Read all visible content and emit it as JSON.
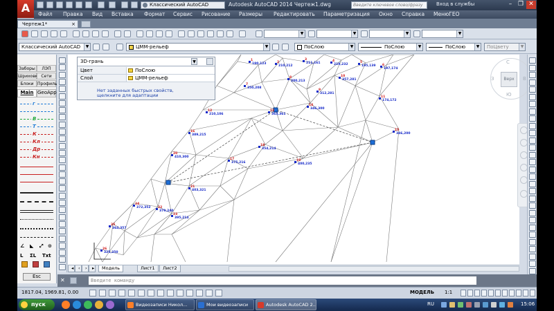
{
  "app": {
    "logo_letter": "A",
    "title": "Autodesk AutoCAD 2014   Чертеж1.dwg",
    "workspace": "Классический AutoCAD",
    "search_placeholder": "Введите ключевое слово/фразу",
    "login": "Вход в службы",
    "win_min": "–",
    "win_restore": "❐",
    "win_close": "✕"
  },
  "menu": [
    "Файл",
    "Правка",
    "Вид",
    "Вставка",
    "Формат",
    "Сервис",
    "Рисование",
    "Размеры",
    "Редактировать",
    "Параметризация",
    "Окно",
    "Справка",
    "МенюГЕО"
  ],
  "doc_tab": {
    "label": "Чертеж1*",
    "close": "×"
  },
  "toolbar2": {
    "workspace": "Классический AutoCAD",
    "layer": "ЦММ-рельеф",
    "color": "ПоСлою",
    "linetype": "ПоСлою",
    "lineweight": "ПоСлою",
    "plotstyle": "ПоЦвету"
  },
  "left_palette": {
    "tabs_row1": [
      "Заборы",
      "ЛЭП"
    ],
    "tabs_row2": [
      "Шриховка",
      "Сети"
    ],
    "tabs_row3": [
      "Блоки",
      "Профиль"
    ],
    "tabs_main": [
      "Main",
      "GeoApp"
    ],
    "lines": [
      {
        "label": "г",
        "color": "#1e7bd6"
      },
      {
        "label": "",
        "color": "#1e7bd6"
      },
      {
        "label": "В",
        "color": "#1ea83a"
      },
      {
        "label": "Т",
        "color": "#1e7bd6"
      },
      {
        "label": "К",
        "color": "#c81e1e"
      },
      {
        "label": "Кл",
        "color": "#c81e1e"
      },
      {
        "label": "Др",
        "color": "#c81e1e"
      },
      {
        "label": "Кн",
        "color": "#c81e1e"
      }
    ],
    "text_tools": [
      "L",
      "ΣL",
      "Txt"
    ],
    "esc": "Esc"
  },
  "properties": {
    "object": "3D-грань",
    "rows": [
      {
        "key": "Цвет",
        "value": "ПоСлою"
      },
      {
        "key": "Слой",
        "value": "ЦММ-рельеф"
      }
    ],
    "link_line1": "Нет заданных быстрых свойств,",
    "link_line2": "щелкните для адаптации"
  },
  "viewcube": {
    "top": "Верх",
    "north": "С",
    "south": "Ю",
    "west": "З",
    "east": "В"
  },
  "layout_tabs": [
    "Модель",
    "Лист1",
    "Лист2"
  ],
  "command": {
    "placeholder": "Введите команду",
    "close": "✕"
  },
  "status": {
    "coords": "1817.04, 1969.81, 0.00",
    "model": "МОДЕЛЬ",
    "scale": "1:1"
  },
  "taskbar": {
    "start": "пуск",
    "buttons": [
      "Видеозаписи Никол...",
      "Мои видеозаписи",
      "Autodesk AutoCAD 2..."
    ],
    "lang": "RU",
    "clock": "15:06"
  },
  "drawing_labels": [
    "190,123",
    "210,212",
    "211,161",
    "219,232",
    "195,139",
    "197,174",
    "350,208",
    "200,213",
    "312,281",
    "357,281",
    "174,172",
    "210,106",
    "363,361",
    "346,300",
    "346,200",
    "389,215",
    "375,216",
    "354,214",
    "400,235",
    "410,300",
    "403,321",
    "379,240",
    "395,214",
    "372,352",
    "364,357",
    "325,350"
  ],
  "colors": {
    "triangle_lines": "#7a7a7a",
    "label_red": "#d01818",
    "label_blue": "#1428c8",
    "grip": "#1e6fd8"
  }
}
